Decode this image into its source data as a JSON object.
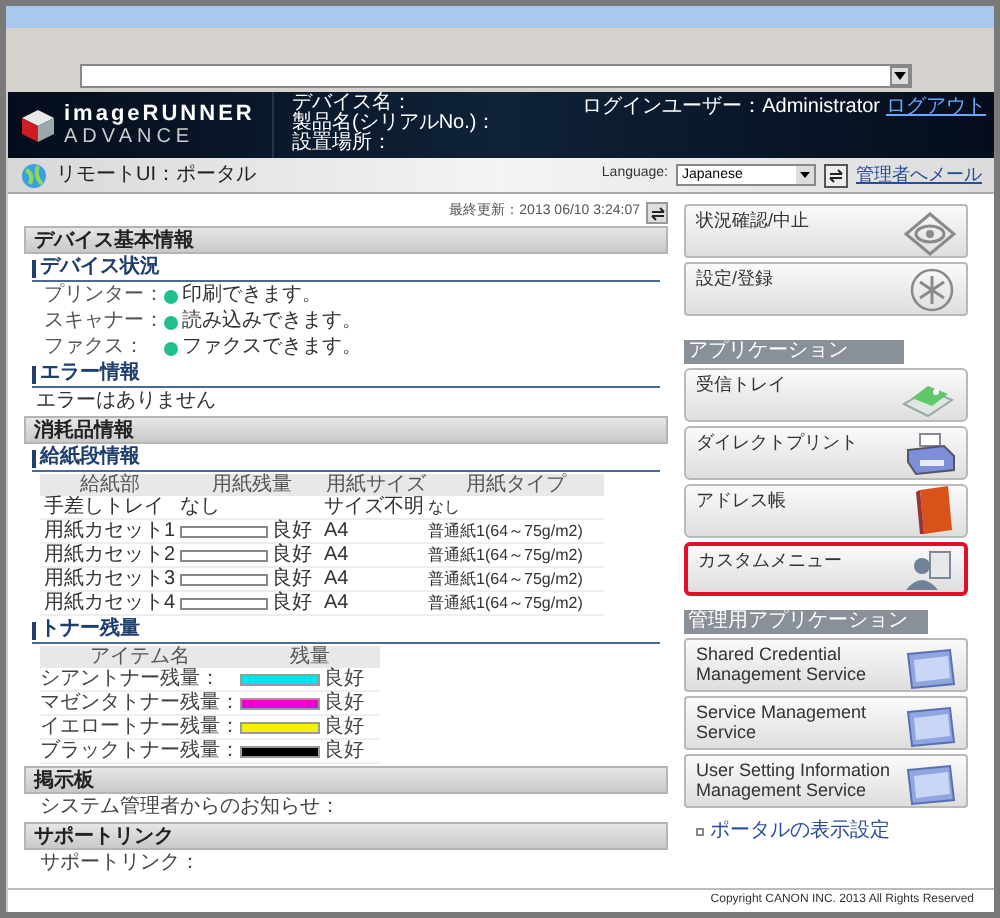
{
  "header": {
    "logo_line1": "imageRUNNER",
    "logo_line2": "ADVANCE",
    "device_fields": [
      "デバイス名：",
      "製品名(シリアルNo.)：",
      "設置場所："
    ],
    "login_label": "ログインユーザー：Administrator",
    "logout_link": "ログアウト"
  },
  "nav": {
    "title": "リモートUI：ポータル",
    "language_label": "Language:",
    "language_value": "Japanese",
    "admin_mail_link": "管理者へメール"
  },
  "last_updated": "最終更新：2013 06/10 3:24:07",
  "device_info": {
    "title": "デバイス基本情報",
    "status_title": "デバイス状況",
    "statuses": [
      {
        "label": "プリンター：",
        "value": "印刷できます。"
      },
      {
        "label": "スキャナー：",
        "value": "読み込みできます。"
      },
      {
        "label": "ファクス：",
        "value": "ファクスできます。"
      }
    ],
    "error_title": "エラー情報",
    "error_text": "エラーはありません"
  },
  "consumables": {
    "title": "消耗品情報",
    "paper_title": "給紙段情報",
    "paper_columns": [
      "給紙部",
      "用紙残量",
      "用紙サイズ",
      "用紙タイプ"
    ],
    "paper_rows": [
      {
        "source": "手差しトレイ",
        "remaining": "なし",
        "bar": false,
        "size": "サイズ不明",
        "type": "なし"
      },
      {
        "source": "用紙カセット1",
        "remaining": "良好",
        "bar": true,
        "size": "A4",
        "type": "普通紙1(64～75g/m2)"
      },
      {
        "source": "用紙カセット2",
        "remaining": "良好",
        "bar": true,
        "size": "A4",
        "type": "普通紙1(64～75g/m2)"
      },
      {
        "source": "用紙カセット3",
        "remaining": "良好",
        "bar": true,
        "size": "A4",
        "type": "普通紙1(64～75g/m2)"
      },
      {
        "source": "用紙カセット4",
        "remaining": "良好",
        "bar": true,
        "size": "A4",
        "type": "普通紙1(64～75g/m2)"
      }
    ],
    "toner_title": "トナー残量",
    "toner_columns": [
      "アイテム名",
      "残量"
    ],
    "toners": [
      {
        "name": "シアントナー残量：",
        "color": "#00e5f0",
        "level": 1,
        "status": "良好"
      },
      {
        "name": "マゼンタトナー残量：",
        "color": "#f000d0",
        "level": 1,
        "status": "良好"
      },
      {
        "name": "イエロートナー残量：",
        "color": "#f5f000",
        "level": 1,
        "status": "良好"
      },
      {
        "name": "ブラックトナー残量：",
        "color": "#000000",
        "level": 1,
        "status": "良好"
      }
    ]
  },
  "bulletin": {
    "title": "掲示板",
    "text": "システム管理者からのお知らせ："
  },
  "support": {
    "title": "サポートリンク",
    "text": "サポートリンク："
  },
  "top_buttons": [
    {
      "label": "状況確認/中止",
      "kind": "eye"
    },
    {
      "label": "設定/登録",
      "kind": "settings"
    }
  ],
  "applications": {
    "title": "アプリケーション",
    "items": [
      {
        "label": "受信トレイ",
        "kind": "tray",
        "highlighted": false
      },
      {
        "label": "ダイレクトプリント",
        "kind": "printer",
        "highlighted": false
      },
      {
        "label": "アドレス帳",
        "kind": "book",
        "highlighted": false
      },
      {
        "label": "カスタムメニュー",
        "kind": "person",
        "highlighted": true
      }
    ]
  },
  "admin_applications": {
    "title": "管理用アプリケーション",
    "items": [
      {
        "label": "Shared Credential Management Service",
        "kind": "window"
      },
      {
        "label": "Service Management Service",
        "kind": "window"
      },
      {
        "label": "User Setting Information Management Service",
        "kind": "window"
      }
    ]
  },
  "portal_settings_link": "ポータルの表示設定",
  "copyright": "Copyright CANON INC. 2013 All Rights Reserved"
}
